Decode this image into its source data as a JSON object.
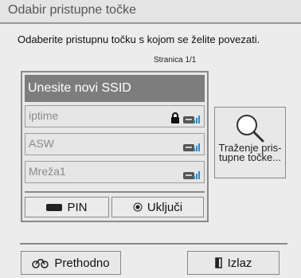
{
  "dialog": {
    "title": "Odabir pristupne točke",
    "instruction": "Odaberite pristupnu točku s kojom se želite povezati.",
    "page_indicator": "Stranica 1/1"
  },
  "list": {
    "new_ssid_label": "Unesite novi SSID",
    "networks": [
      {
        "name": "iptime",
        "icon": "router-signal-icon",
        "locked": true
      },
      {
        "name": "ASW",
        "icon": "router-signal-icon",
        "locked": false
      },
      {
        "name": "Mreža1",
        "icon": "router-signal-icon",
        "locked": false
      }
    ],
    "pin_label": "PIN",
    "ukljuci_label": "Uključi"
  },
  "search": {
    "label_line1": "Traženje pris-",
    "label_line2": "tupne točke...",
    "icon": "magnifier-icon"
  },
  "footer": {
    "back_label": "Prethodno",
    "exit_label": "Izlaz"
  },
  "colors": {
    "selected_row": "#7d7d7d",
    "signal": "#2a8ac8",
    "panel_bg": "#ececec"
  }
}
